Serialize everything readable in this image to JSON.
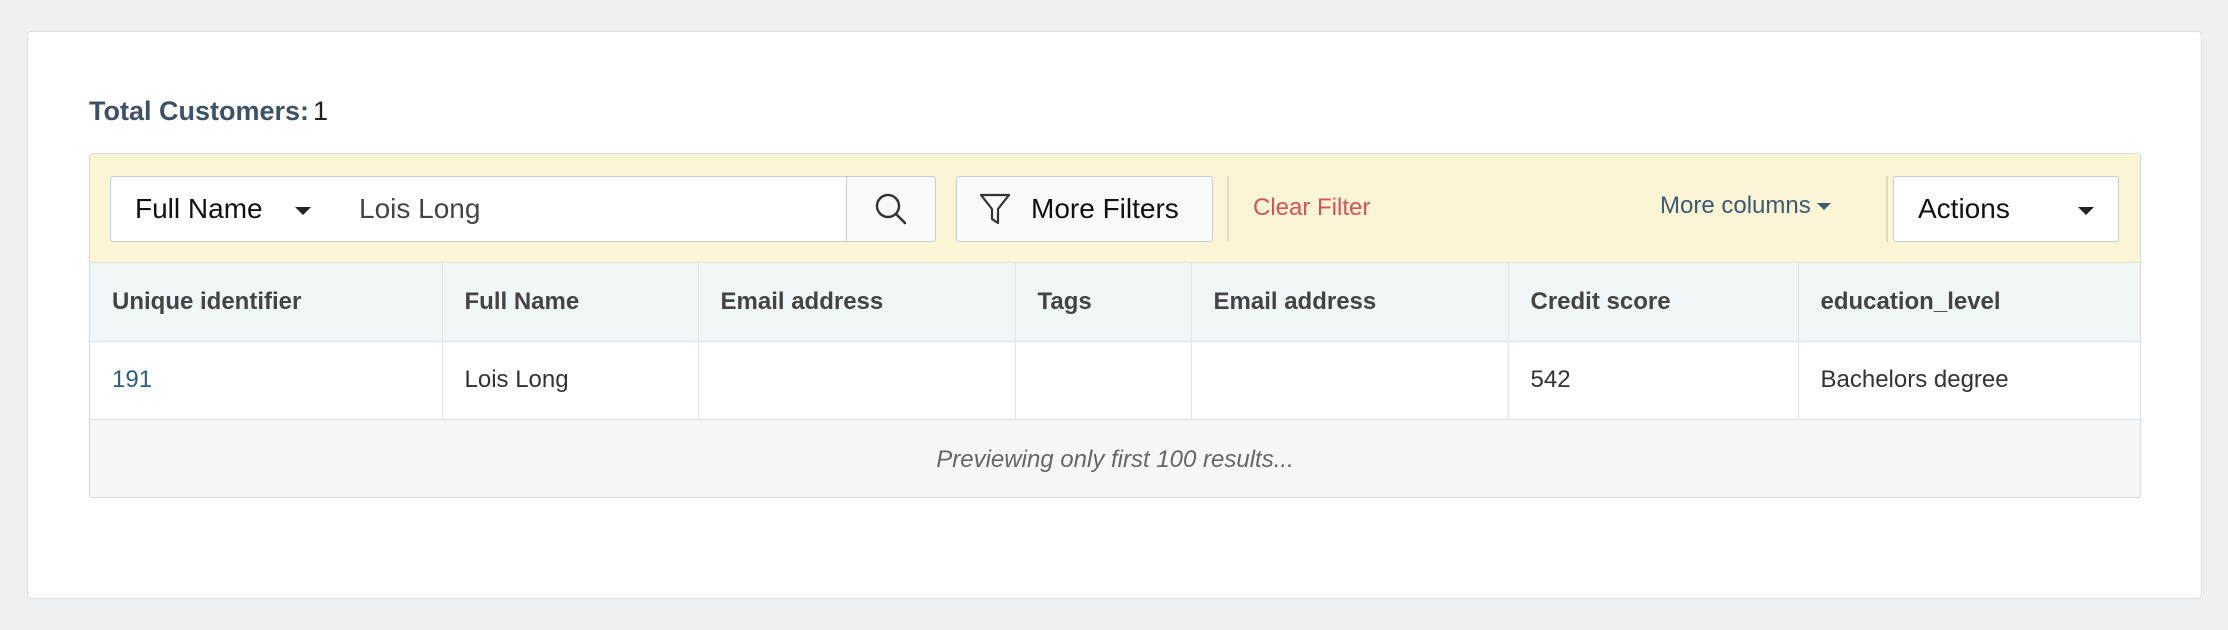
{
  "summary": {
    "label": "Total Customers:",
    "count": "1"
  },
  "toolbar": {
    "field_select": "Full Name",
    "search_value": "Lois Long",
    "more_filters_label": "More Filters",
    "clear_filter_label": "Clear Filter",
    "more_columns_label": "More columns",
    "actions_label": "Actions"
  },
  "table": {
    "columns": [
      "Unique identifier",
      "Full Name",
      "Email address",
      "Tags",
      "Email address",
      "Credit score",
      "education_level"
    ],
    "rows": [
      [
        "191",
        "Lois Long",
        "",
        "",
        "",
        "542",
        "Bachelors degree"
      ]
    ],
    "footer_note": "Previewing only first 100 results..."
  }
}
